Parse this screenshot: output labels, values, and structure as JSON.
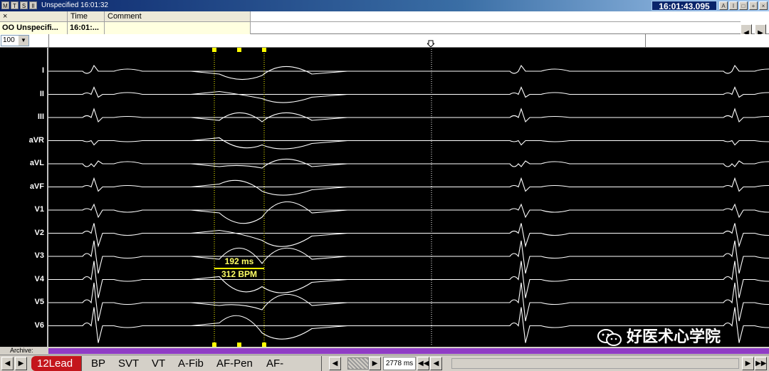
{
  "titlebar": {
    "mode_buttons": [
      "M",
      "T",
      "S",
      "II"
    ],
    "title": "Unspecified  16:01:32",
    "clock": "16:01:43.095",
    "window_buttons": [
      "A",
      "I",
      "□",
      "+",
      "×"
    ]
  },
  "events": {
    "close_glyph": "×",
    "columns": [
      "Time",
      "Comment"
    ],
    "row": {
      "name": "OO Unspecifi...",
      "time": "16:01:...",
      "comment": ""
    }
  },
  "zoom": {
    "value": "100"
  },
  "leads": [
    "I",
    "II",
    "III",
    "aVR",
    "aVL",
    "aVF",
    "V1",
    "V2",
    "V3",
    "V4",
    "V5",
    "V6"
  ],
  "caliper": {
    "interval": "192 ms",
    "rate": "312 BPM"
  },
  "watermark": {
    "text": "好医术心学院"
  },
  "archive": {
    "label": "Archive:"
  },
  "tabs": [
    "12Lead",
    "BP",
    "SVT",
    "VT",
    "A-Fib",
    "AF-Pen",
    "AF-CRYO"
  ],
  "active_tab": "12Lead",
  "playback": {
    "window": "2778 ms"
  },
  "colors": {
    "accent_tab": "#c4161c",
    "archive_bar": "#8f3cc5",
    "caliper": "#ffff00",
    "trace": "#ffffff"
  }
}
